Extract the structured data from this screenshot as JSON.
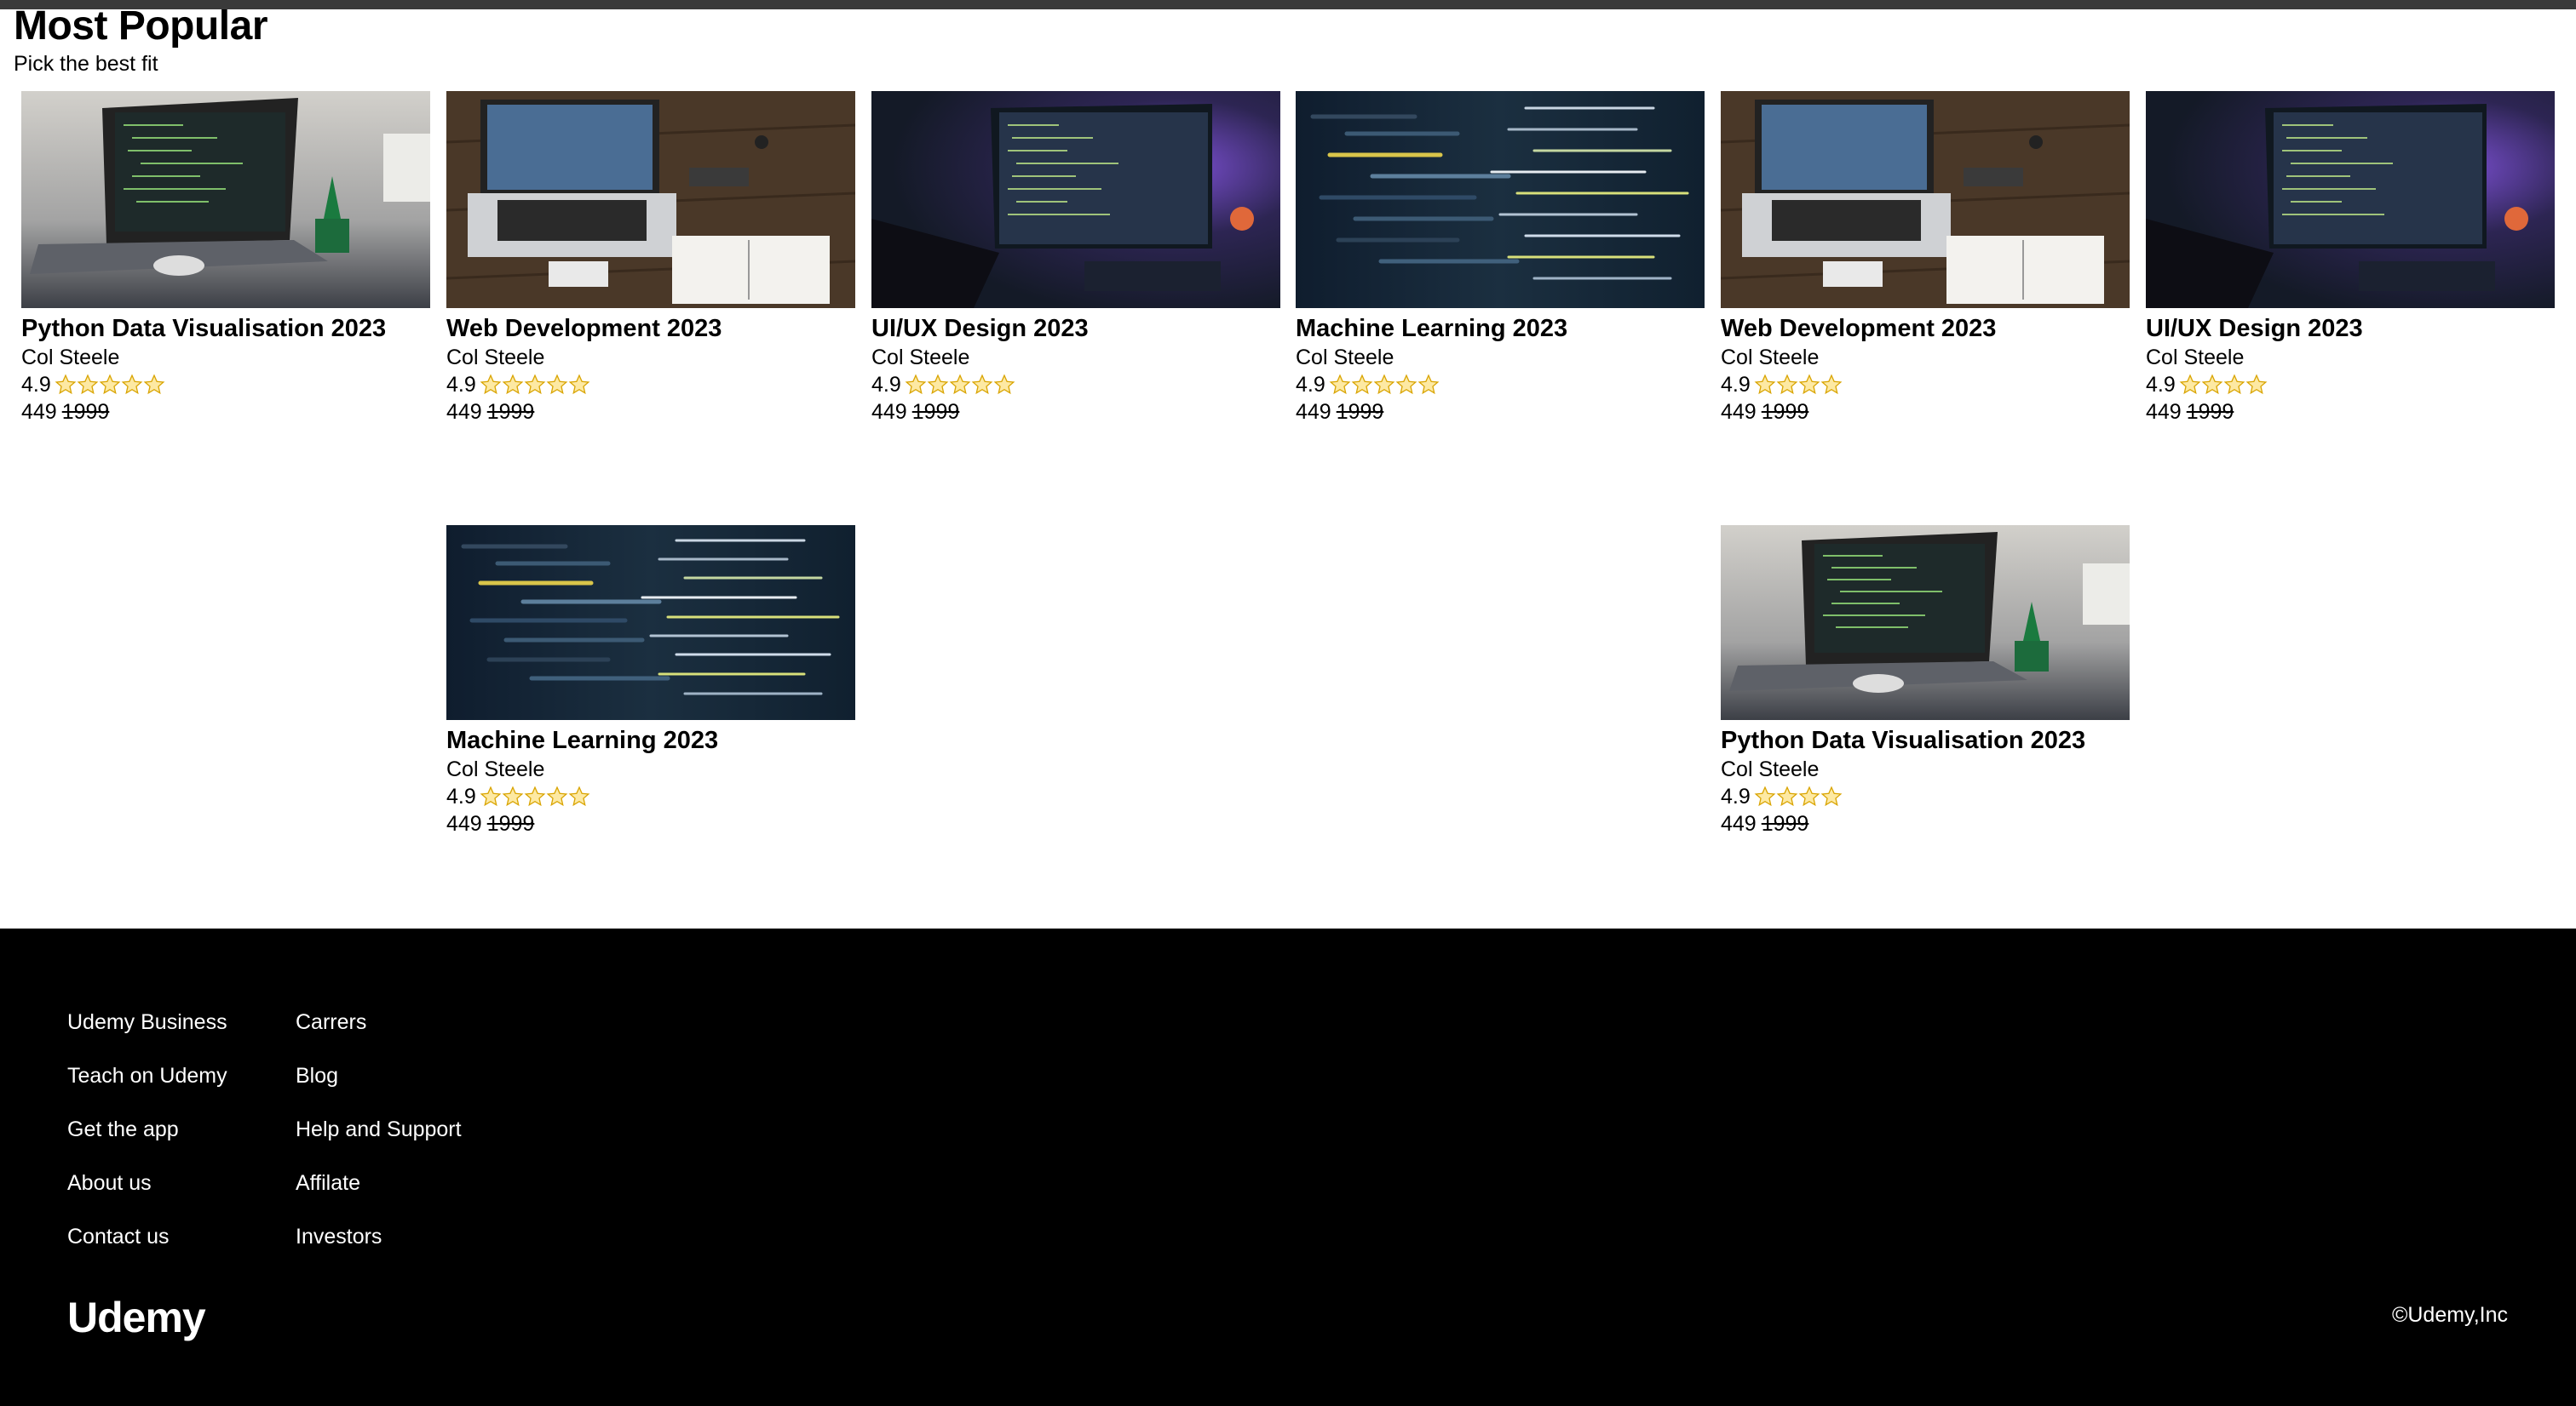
{
  "section": {
    "title": "Most Popular",
    "subtitle": "Pick the best fit"
  },
  "cards": [
    {
      "title": "Python Data Visualisation 2023",
      "author": "Col Steele",
      "rating": "4.9",
      "stars": 5,
      "price": "449",
      "old_price": "1999",
      "image": "laptop-with-plant"
    },
    {
      "title": "Web Development 2023",
      "author": "Col Steele",
      "rating": "4.9",
      "stars": 5,
      "price": "449",
      "old_price": "1999",
      "image": "laptop-on-wood-desk"
    },
    {
      "title": "UI/UX Design 2023",
      "author": "Col Steele",
      "rating": "4.9",
      "stars": 5,
      "price": "449",
      "old_price": "1999",
      "image": "monitor-purple-light"
    },
    {
      "title": "Machine Learning 2023",
      "author": "Col Steele",
      "rating": "4.9",
      "stars": 5,
      "price": "449",
      "old_price": "1999",
      "image": "code-closeup"
    },
    {
      "title": "Web Development 2023",
      "author": "Col Steele",
      "rating": "4.9",
      "stars": 4,
      "price": "449",
      "old_price": "1999",
      "image": "laptop-on-wood-desk"
    },
    {
      "title": "UI/UX Design 2023",
      "author": "Col Steele",
      "rating": "4.9",
      "stars": 4,
      "price": "449",
      "old_price": "1999",
      "image": "monitor-purple-light"
    },
    {
      "title": "Machine Learning 2023",
      "author": "Col Steele",
      "rating": "4.9",
      "stars": 5,
      "price": "449",
      "old_price": "1999",
      "image": "code-closeup"
    },
    {
      "title": "Python Data Visualisation 2023",
      "author": "Col Steele",
      "rating": "4.9",
      "stars": 4,
      "price": "449",
      "old_price": "1999",
      "image": "laptop-with-plant"
    }
  ],
  "footer": {
    "col1": [
      "Udemy Business",
      "Teach on Udemy",
      "Get the app",
      "About us",
      "Contact us"
    ],
    "col2": [
      "Carrers",
      "Blog",
      "Help and Support",
      "Affilate",
      "Investors"
    ],
    "logo": "Udemy",
    "copyright": "©Udemy,Inc"
  },
  "colors": {
    "topbar": "#3a3a3a",
    "footer_bg": "#000000",
    "star_fill": "#fde9a3",
    "star_stroke": "#d9a400"
  }
}
